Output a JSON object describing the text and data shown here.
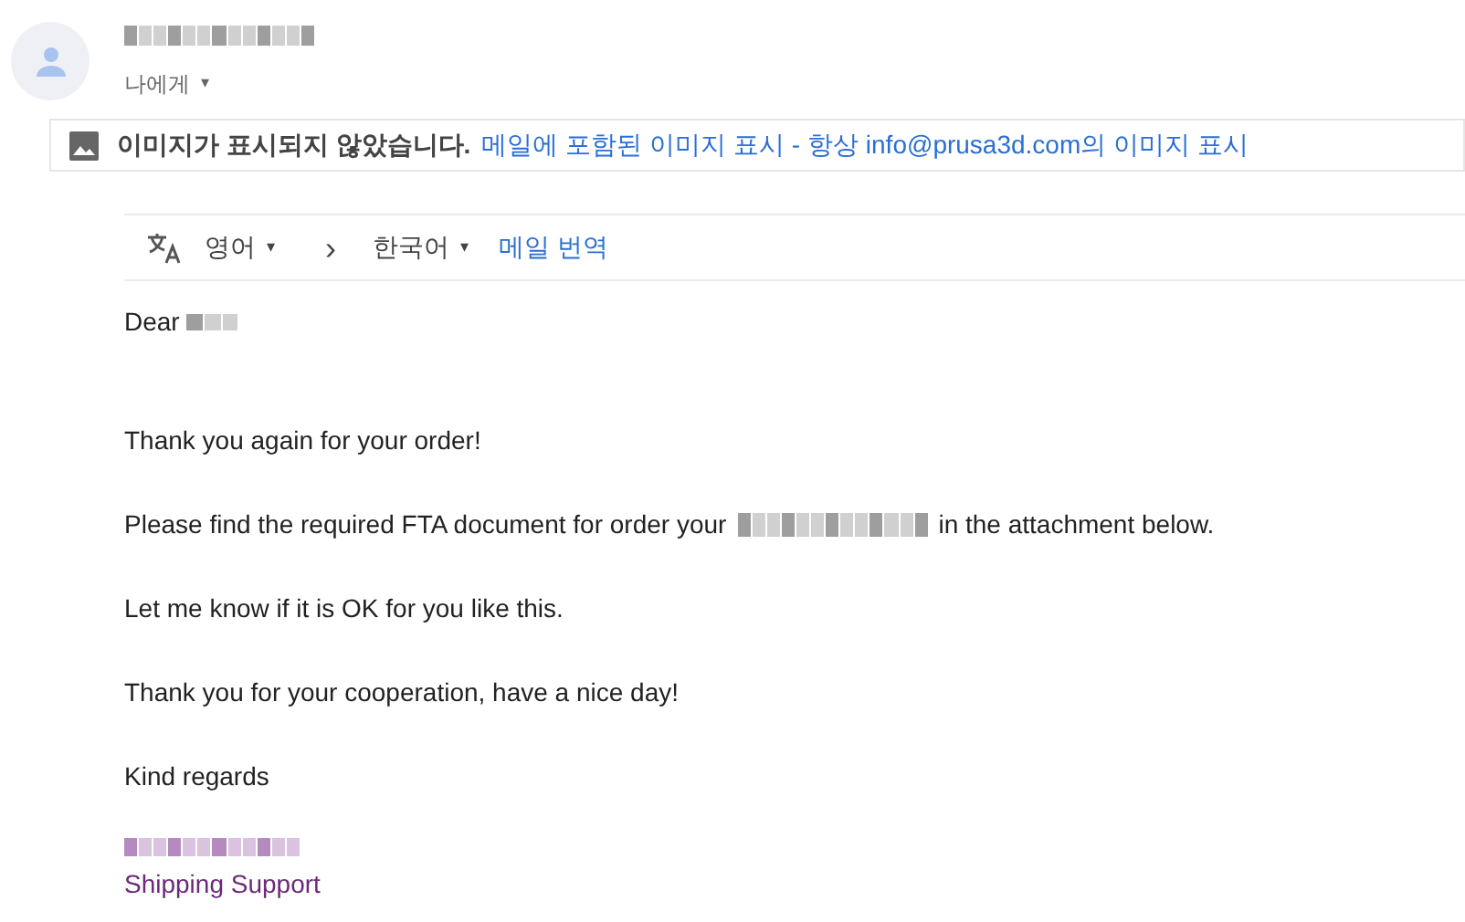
{
  "recipient": {
    "label": "나에게",
    "caret": "▾"
  },
  "image_notice": {
    "text": "이미지가 표시되지 않았습니다.",
    "link_show": "메일에 포함된 이미지 표시",
    "separator": "-",
    "link_always": "항상 info@prusa3d.com의 이미지 표시"
  },
  "translate_bar": {
    "source_language": "영어",
    "source_caret": "▾",
    "arrow": "›",
    "target_language": "한국어",
    "target_caret": "▾",
    "translate_link": "메일 번역"
  },
  "body": [
    {
      "kind": "greeting",
      "text": "Dear"
    },
    {
      "kind": "text",
      "text": "Thank you again for your order!"
    },
    {
      "kind": "redacted",
      "before": "Please find the required FTA document for order your",
      "after": "in the attachment below."
    },
    {
      "kind": "text",
      "text": "Let me know if it is OK for you like this."
    },
    {
      "kind": "text",
      "text": "Thank you for your cooperation, have a nice day!"
    },
    {
      "kind": "text",
      "text": "Kind regards"
    }
  ],
  "signature": {
    "title": "Shipping Support"
  }
}
